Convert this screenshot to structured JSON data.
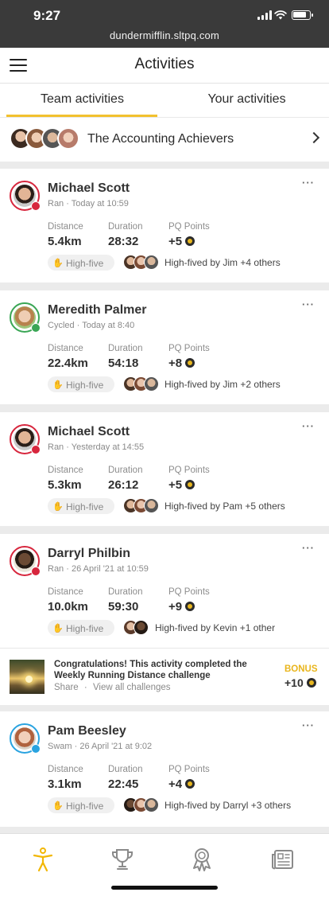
{
  "status_bar": {
    "time": "9:27",
    "url": "dundermifflin.sltpq.com"
  },
  "header": {
    "title": "Activities"
  },
  "tabs": [
    {
      "label": "Team activities",
      "active": true
    },
    {
      "label": "Your activities",
      "active": false
    }
  ],
  "team": {
    "name": "The Accounting Achievers"
  },
  "stat_labels": {
    "distance": "Distance",
    "duration": "Duration",
    "points": "PQ Points"
  },
  "high_five_label": "High-five",
  "more_label": "···",
  "activities": [
    {
      "name": "Michael Scott",
      "subtitle": "Ran · Today at 10:59",
      "distance": "5.4km",
      "duration": "28:32",
      "points": "+5",
      "high_fived_by": "High-fived by Jim +4 others"
    },
    {
      "name": "Meredith Palmer",
      "subtitle": "Cycled · Today at 8:40",
      "distance": "22.4km",
      "duration": "54:18",
      "points": "+8",
      "high_fived_by": "High-fived by Jim +2 others"
    },
    {
      "name": "Michael Scott",
      "subtitle": "Ran · Yesterday at 14:55",
      "distance": "5.3km",
      "duration": "26:12",
      "points": "+5",
      "high_fived_by": "High-fived by Pam +5 others"
    },
    {
      "name": "Darryl Philbin",
      "subtitle": "Ran · 26 April '21 at 10:59",
      "distance": "10.0km",
      "duration": "59:30",
      "points": "+9",
      "high_fived_by": "High-fived by Kevin +1 other"
    },
    {
      "name": "Pam Beesley",
      "subtitle": "Swam · 26 April '21 at 9:02",
      "distance": "3.1km",
      "duration": "22:45",
      "points": "+4",
      "high_fived_by": "High-fived by Darryl +3 others"
    }
  ],
  "challenge": {
    "message": "Congratulations! This activity completed the Weekly Running Distance challenge",
    "share": "Share",
    "separator": "·",
    "view_all": "View all challenges",
    "bonus_label": "BONUS",
    "bonus_points": "+10"
  },
  "bottom_nav": [
    {
      "icon": "activity-person-icon",
      "active": true
    },
    {
      "icon": "trophy-icon",
      "active": false
    },
    {
      "icon": "award-ribbon-icon",
      "active": false
    },
    {
      "icon": "newspaper-icon",
      "active": false
    }
  ],
  "colors": {
    "accent": "#f2c12e",
    "run_badge": "#d7263d",
    "cycle_badge": "#3aa655",
    "swim_badge": "#29a3e0"
  }
}
